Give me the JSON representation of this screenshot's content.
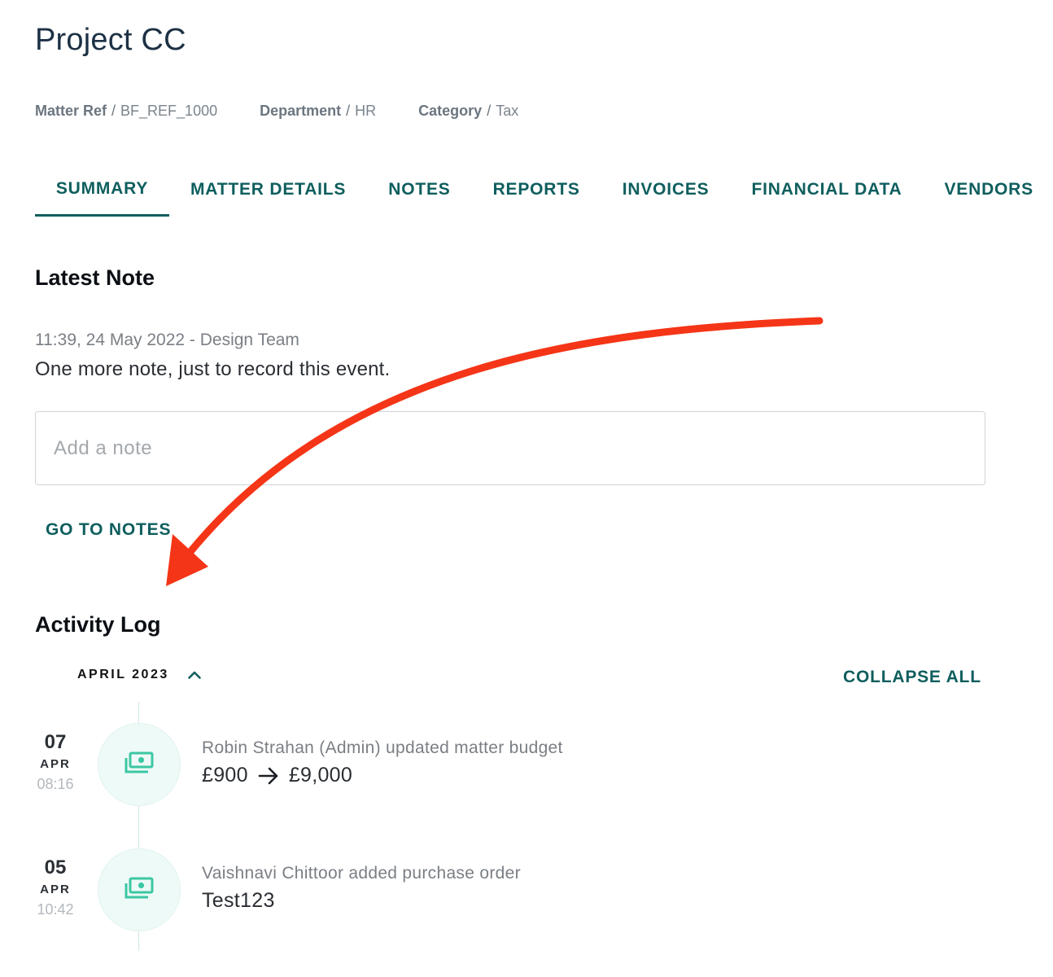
{
  "header": {
    "title": "Project CC",
    "meta": [
      {
        "label": "Matter Ref",
        "value": "BF_REF_1000"
      },
      {
        "label": "Department",
        "value": "HR"
      },
      {
        "label": "Category",
        "value": "Tax"
      }
    ],
    "separator": "/"
  },
  "tabs": [
    {
      "label": "SUMMARY",
      "active": true
    },
    {
      "label": "MATTER DETAILS",
      "active": false
    },
    {
      "label": "NOTES",
      "active": false
    },
    {
      "label": "REPORTS",
      "active": false
    },
    {
      "label": "INVOICES",
      "active": false
    },
    {
      "label": "FINANCIAL DATA",
      "active": false
    },
    {
      "label": "VENDORS",
      "active": false
    }
  ],
  "latest_note": {
    "heading": "Latest Note",
    "meta": "11:39, 24 May 2022 - Design Team",
    "body": "One more note, just to record this event.",
    "input_placeholder": "Add a note",
    "input_value": "",
    "go_to_notes": "GO TO NOTES"
  },
  "activity_log": {
    "heading": "Activity Log",
    "month": "APRIL 2023",
    "month_expanded": true,
    "collapse_all": "COLLAPSE ALL",
    "entries": [
      {
        "day": "07",
        "month": "APR",
        "time": "08:16",
        "icon": "money-icon",
        "title": "Robin Strahan (Admin) updated matter budget",
        "from": "£900",
        "to": "£9,000"
      },
      {
        "day": "05",
        "month": "APR",
        "time": "10:42",
        "icon": "money-icon",
        "title": "Vaishnavi Chittoor added purchase order",
        "value": "Test123"
      }
    ]
  },
  "colors": {
    "accent": "#0f5e5e",
    "icon_teal": "#3cc7a4",
    "annotation_arrow": "#f53517"
  }
}
